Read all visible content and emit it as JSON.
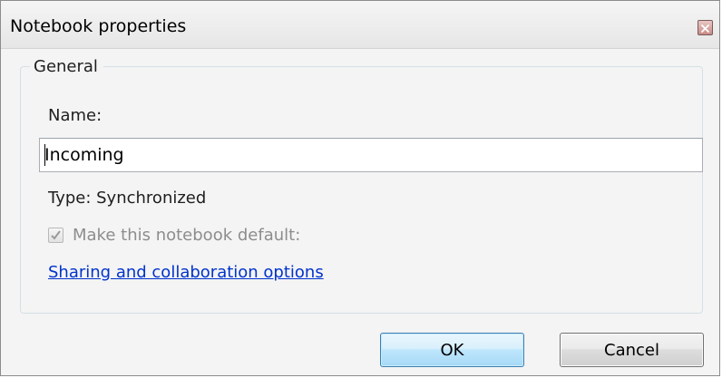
{
  "window": {
    "title": "Notebook properties",
    "close_icon": "close-icon"
  },
  "general": {
    "legend": "General",
    "name_label": "Name:",
    "name_value": "Incoming",
    "type_label": "Type: Synchronized",
    "default_checkbox": {
      "label": "Make this notebook default:",
      "checked": true,
      "disabled": true
    },
    "sharing_link": "Sharing and collaboration options"
  },
  "buttons": {
    "ok_label": "OK",
    "cancel_label": "Cancel"
  },
  "colors": {
    "link": "#0033cc",
    "disabled_text": "#8d8d8d",
    "ok_border": "#3c7fb1"
  }
}
